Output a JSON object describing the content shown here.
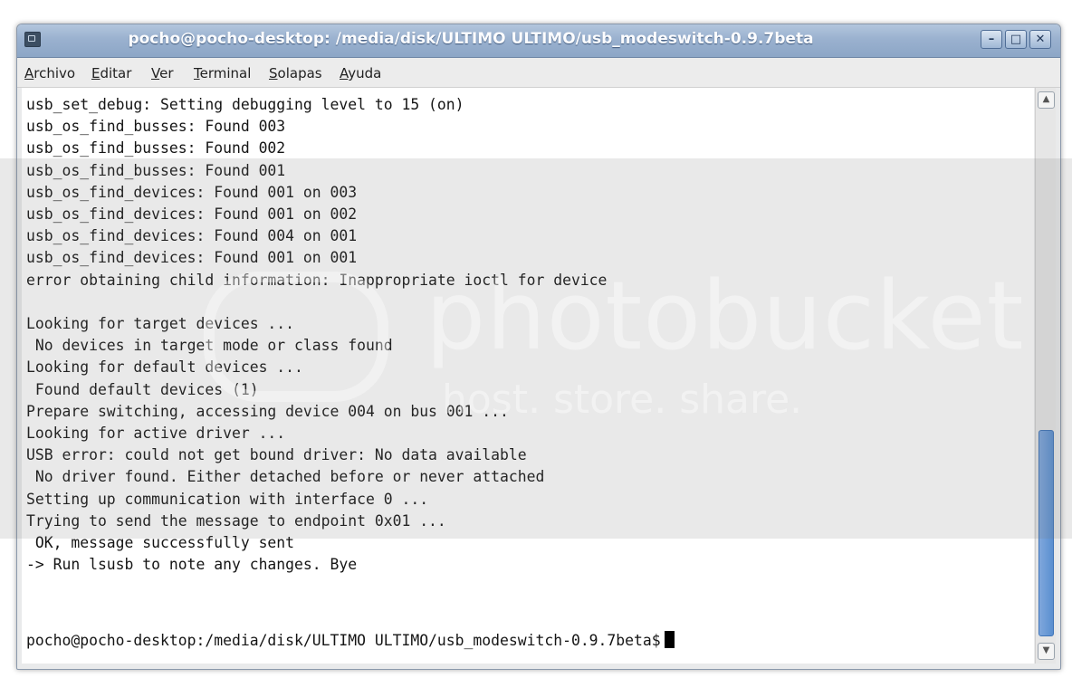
{
  "window": {
    "title": "pocho@pocho-desktop: /media/disk/ULTIMO ULTIMO/usb_modeswitch-0.9.7beta",
    "buttons": {
      "minimize": "–",
      "maximize": "□",
      "close": "✕"
    }
  },
  "menubar": {
    "items": [
      "Archivo",
      "Editar",
      "Ver",
      "Terminal",
      "Solapas",
      "Ayuda"
    ]
  },
  "terminal": {
    "output": "usb_set_debug: Setting debugging level to 15 (on)\nusb_os_find_busses: Found 003\nusb_os_find_busses: Found 002\nusb_os_find_busses: Found 001\nusb_os_find_devices: Found 001 on 003\nusb_os_find_devices: Found 001 on 002\nusb_os_find_devices: Found 004 on 001\nusb_os_find_devices: Found 001 on 001\nerror obtaining child information: Inappropriate ioctl for device\n\nLooking for target devices ...\n No devices in target mode or class found\nLooking for default devices ...\n Found default devices (1)\nPrepare switching, accessing device 004 on bus 001 ...\nLooking for active driver ...\nUSB error: could not get bound driver: No data available\n No driver found. Either detached before or never attached\nSetting up communication with interface 0 ...\nTrying to send the message to endpoint 0x01 ...\n OK, message successfully sent\n-> Run lsusb to note any changes. Bye",
    "prompt": "pocho@pocho-desktop:/media/disk/ULTIMO ULTIMO/usb_modeswitch-0.9.7beta$"
  },
  "scrollbar": {
    "up_arrow": "▲",
    "down_arrow": "▼"
  },
  "watermark": {
    "brand": "photobucket",
    "tagline": "host. store. share."
  }
}
